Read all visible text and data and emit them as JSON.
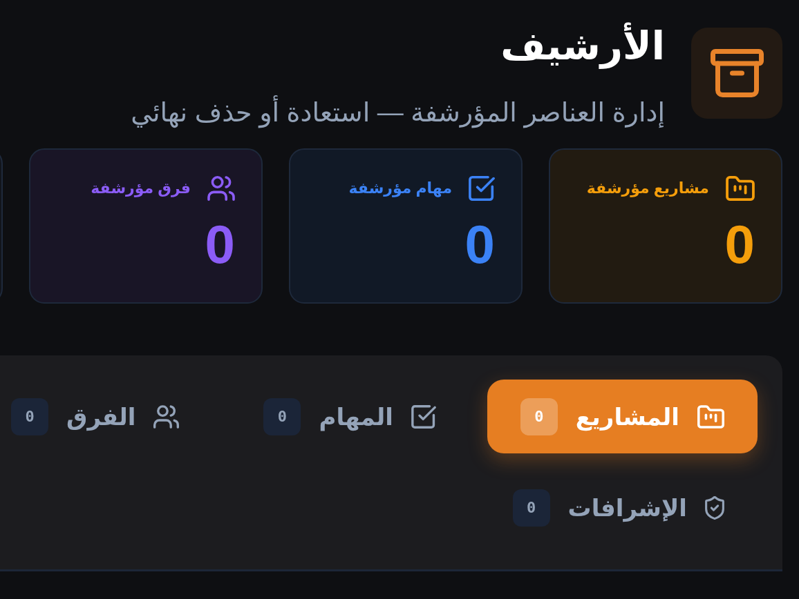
{
  "header": {
    "title": "الأرشيف",
    "subtitle": "إدارة العناصر المؤرشفة — استعادة أو حذف نهائي"
  },
  "stats": [
    {
      "kind": "projects",
      "label": "مشاريع مؤرشفة",
      "value": "0",
      "color": "#f59e0b"
    },
    {
      "kind": "tasks",
      "label": "مهام مؤرشفة",
      "value": "0",
      "color": "#3b82f6"
    },
    {
      "kind": "teams",
      "label": "فرق مؤرشفة",
      "value": "0",
      "color": "#8b5cf6"
    }
  ],
  "tabs": [
    {
      "kind": "projects",
      "label": "المشاريع",
      "count": "0",
      "selected": true
    },
    {
      "kind": "tasks",
      "label": "المهام",
      "count": "0",
      "selected": false
    },
    {
      "kind": "teams",
      "label": "الفرق",
      "count": "0",
      "selected": false
    },
    {
      "kind": "supervisions",
      "label": "الإشرافات",
      "count": "0",
      "selected": false
    }
  ]
}
